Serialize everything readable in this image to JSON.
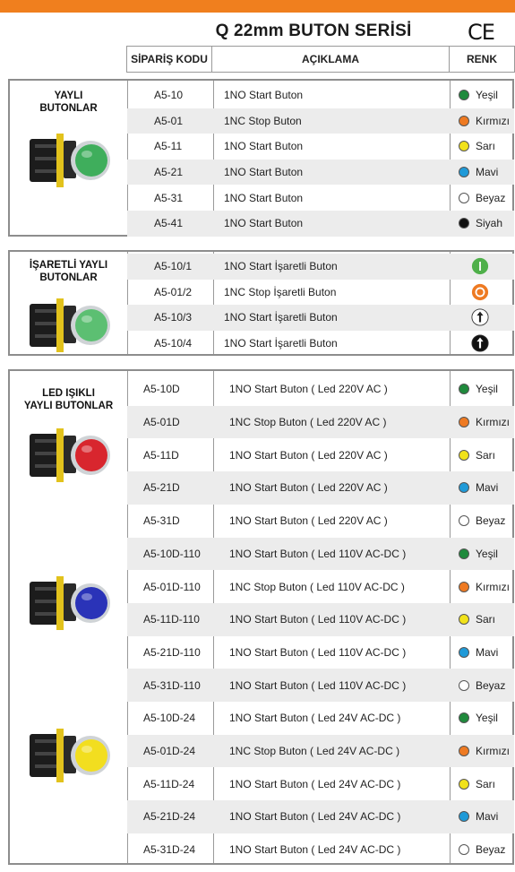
{
  "title": "Q 22mm BUTON SERİSİ",
  "ce_mark": "CE",
  "header": {
    "code": "SİPARİŞ KODU",
    "desc": "AÇIKLAMA",
    "color": "RENK"
  },
  "colors": {
    "Yeşil": "#1f8a3c",
    "Kırmızı": "#ee7a22",
    "Sarı": "#f1e21a",
    "Mavi": "#1f9ad8",
    "Beyaz": "#ffffff",
    "Siyah": "#111111",
    "accent": "#f07f1e"
  },
  "sections": [
    {
      "title": [
        "YAYLI",
        "BUTONLAR"
      ],
      "rows": [
        {
          "code": "A5-10",
          "desc": "1NO Start Buton",
          "color": "Yeşil"
        },
        {
          "code": "A5-01",
          "desc": "1NC Stop Buton",
          "color": "Kırmızı"
        },
        {
          "code": "A5-11",
          "desc": "1NO Start Buton",
          "color": "Sarı"
        },
        {
          "code": "A5-21",
          "desc": "1NO Start Buton",
          "color": "Mavi"
        },
        {
          "code": "A5-31",
          "desc": "1NO Start Buton",
          "color": "Beyaz"
        },
        {
          "code": "A5-41",
          "desc": "1NO Start Buton",
          "color": "Siyah"
        }
      ]
    },
    {
      "title": [
        "İŞARETLİ YAYLI",
        "BUTONLAR"
      ],
      "rows": [
        {
          "code": "A5-10/1",
          "desc": "1NO Start İşaretli Buton",
          "icon": "green-start-icon"
        },
        {
          "code": "A5-01/2",
          "desc": "1NC Stop  İşaretli Buton",
          "icon": "orange-stop-icon"
        },
        {
          "code": "A5-10/3",
          "desc": "1NO Start İşaretli Buton",
          "icon": "white-arrow-icon"
        },
        {
          "code": "A5-10/4",
          "desc": "1NO Start İşaretli Buton",
          "icon": "black-arrow-icon"
        }
      ]
    },
    {
      "title": [
        "LED IŞIKLI",
        "YAYLI BUTONLAR"
      ],
      "rows": [
        {
          "code": "A5-10D",
          "desc": "1NO Start Buton ( Led 220V AC )",
          "color": "Yeşil"
        },
        {
          "code": "A5-01D",
          "desc": "1NC Stop Buton ( Led 220V AC )",
          "color": "Kırmızı"
        },
        {
          "code": "A5-11D",
          "desc": "1NO Start Buton ( Led 220V AC )",
          "color": "Sarı"
        },
        {
          "code": "A5-21D",
          "desc": "1NO Start Buton ( Led 220V AC )",
          "color": "Mavi"
        },
        {
          "code": "A5-31D",
          "desc": "1NO Start Buton ( Led 220V AC )",
          "color": "Beyaz"
        },
        {
          "code": "A5-10D-110",
          "desc": "1NO  Start Buton ( Led 110V AC-DC )",
          "color": "Yeşil"
        },
        {
          "code": "A5-01D-110",
          "desc": "1NC Stop Buton ( Led 110V AC-DC )",
          "color": "Kırmızı"
        },
        {
          "code": "A5-11D-110",
          "desc": "1NO Start Buton ( Led 110V AC-DC )",
          "color": "Sarı"
        },
        {
          "code": "A5-21D-110",
          "desc": "1NO Start Buton ( Led 110V AC-DC )",
          "color": "Mavi"
        },
        {
          "code": "A5-31D-110",
          "desc": "1NO Start Buton ( Led 110V AC-DC )",
          "color": "Beyaz"
        },
        {
          "code": "A5-10D-24",
          "desc": "1NO Start Buton ( Led 24V AC-DC )",
          "color": "Yeşil"
        },
        {
          "code": "A5-01D-24",
          "desc": "1NC Stop Buton ( Led 24V AC-DC )",
          "color": "Kırmızı"
        },
        {
          "code": "A5-11D-24",
          "desc": "1NO Start Buton ( Led 24V AC-DC )",
          "color": "Sarı"
        },
        {
          "code": "A5-21D-24",
          "desc": "1NO Start Buton ( Led 24V AC-DC )",
          "color": "Mavi"
        },
        {
          "code": "A5-31D-24",
          "desc": "1NO Start Buton ( Led 24V AC-DC )",
          "color": "Beyaz"
        }
      ]
    }
  ],
  "product_images": [
    {
      "name": "green-push-button",
      "cap": "#3fae5c"
    },
    {
      "name": "green-marked-button",
      "cap": "#5cbf72"
    },
    {
      "name": "red-led-button",
      "cap": "#d8262e"
    },
    {
      "name": "blue-led-button",
      "cap": "#2a33b8"
    },
    {
      "name": "yellow-led-button",
      "cap": "#f2de1f"
    }
  ]
}
